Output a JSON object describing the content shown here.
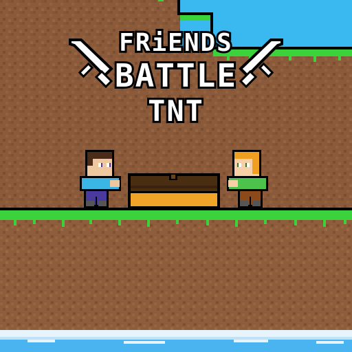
{
  "title": {
    "line1": "FRiENDS",
    "line2": "BATTLE",
    "line3": "TNT"
  },
  "scene": {
    "characters": [
      {
        "name": "blue-shirt-player",
        "shirt": "#3ab5e6",
        "pants": "#4a3aa0",
        "hair": "#4a2c18",
        "skin": "#f0c8a0"
      },
      {
        "name": "green-shirt-player",
        "shirt": "#4cc44c",
        "pants": "#8a4a1a",
        "hair": "#f0a020",
        "skin": "#f7d0a8"
      }
    ],
    "chest": {
      "color_top": "#4a2e12",
      "color_bottom": "#f0a428",
      "latch": "#6a4218"
    },
    "colors": {
      "sky": "#3ab8f0",
      "grass": "#3cd23c",
      "dirt": "#8a5a3a",
      "water": "#4ab4f0",
      "foam": "#e8f4fc"
    }
  }
}
